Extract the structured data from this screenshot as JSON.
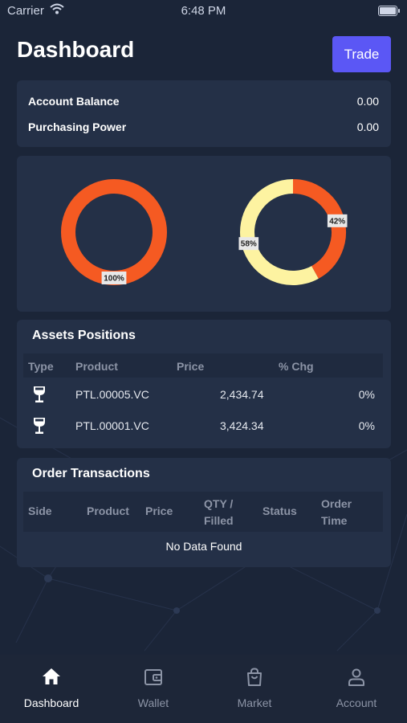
{
  "status_bar": {
    "carrier": "Carrier",
    "time": "6:48 PM"
  },
  "header": {
    "title": "Dashboard",
    "trade_label": "Trade"
  },
  "balances": [
    {
      "label": "Account Balance",
      "value": "0.00"
    },
    {
      "label": "Purchasing Power",
      "value": "0.00"
    }
  ],
  "chart_data": [
    {
      "type": "pie",
      "donut": true,
      "slices": [
        {
          "value": 100,
          "label": "100%",
          "color": "#f55a22"
        }
      ]
    },
    {
      "type": "pie",
      "donut": true,
      "slices": [
        {
          "value": 42,
          "label": "42%",
          "color": "#f55a22"
        },
        {
          "value": 58,
          "label": "58%",
          "color": "#fdf3a1"
        }
      ]
    }
  ],
  "assets": {
    "title": "Assets Positions",
    "columns": [
      "Type",
      "Product",
      "Price",
      "% Chg"
    ],
    "rows": [
      {
        "icon": "wine-glass-icon",
        "product": "PTL.00005.VC",
        "price": "2,434.74",
        "change": "0%"
      },
      {
        "icon": "wine-glass-icon",
        "product": "PTL.00001.VC",
        "price": "3,424.34",
        "change": "0%"
      }
    ]
  },
  "orders": {
    "title": "Order Transactions",
    "columns": [
      "Side",
      "Product",
      "Price",
      "QTY /\nFilled",
      "Status",
      "Order\nTime"
    ],
    "empty_text": "No Data Found"
  },
  "tabs": [
    {
      "label": "Dashboard",
      "icon": "home-icon",
      "active": true
    },
    {
      "label": "Wallet",
      "icon": "wallet-icon",
      "active": false
    },
    {
      "label": "Market",
      "icon": "shopping-bag-icon",
      "active": false
    },
    {
      "label": "Account",
      "icon": "user-icon",
      "active": false
    }
  ],
  "colors": {
    "background": "#1b2538",
    "card": "#243047",
    "accent": "#5b57f5",
    "orange": "#f55a22",
    "yellow": "#fdf3a1"
  }
}
